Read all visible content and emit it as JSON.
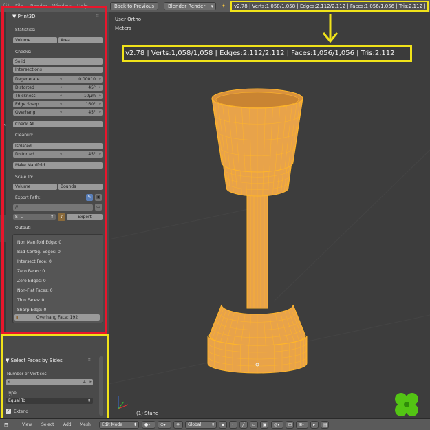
{
  "header": {
    "menus": [
      "File",
      "Render",
      "Window",
      "Help"
    ],
    "back_label": "Back to Previous",
    "engine": "Blender Render",
    "stats": "v2.78 | Verts:1,058/1,058 | Edges:2,112/2,112 | Faces:1,056/1,056 | Tris:2,112 | Mem:20"
  },
  "viewport": {
    "view_name": "User Ortho",
    "units": "Meters",
    "object_label": "(1) Stand",
    "callout_stats": "v2.78 | Verts:1,058/1,058 | Edges:2,112/2,112 | Faces:1,056/1,056 | Tris:2,112"
  },
  "tabs": [
    "Tools",
    "Create",
    "Relations",
    "Shading / UVs",
    "Options",
    "Grease Pencil",
    "Print3D"
  ],
  "print3d": {
    "title": "Print3D",
    "statistics_label": "Statistics:",
    "volume_btn": "Volume",
    "area_btn": "Area",
    "checks_label": "Checks:",
    "solid_btn": "Solid",
    "intersections_btn": "Intersections",
    "fields": [
      {
        "label": "Degenerate",
        "value": "0.00010"
      },
      {
        "label": "Distorted",
        "value": "45°"
      },
      {
        "label": "Thickness",
        "value": "10µm"
      },
      {
        "label": "Edge Sharp",
        "value": "160°"
      },
      {
        "label": "Overhang",
        "value": "45°"
      }
    ],
    "check_all_btn": "Check All",
    "cleanup_label": "Cleanup:",
    "isolated_btn": "Isolated",
    "cleanup_distorted_label": "Distorted",
    "cleanup_distorted_value": "45°",
    "make_manifold_btn": "Make Manifold",
    "scale_label": "Scale To:",
    "scale_volume_btn": "Volume",
    "scale_bounds_btn": "Bounds",
    "export_path_label": "Export Path:",
    "export_path_value": "//",
    "format_value": "STL",
    "export_btn": "Export",
    "output_label": "Output:",
    "output_items": [
      "Non Manifold Edge: 0",
      "Bad Contig. Edges: 0",
      "Intersect Face: 0",
      "Zero Faces: 0",
      "Zero Edges: 0",
      "Non-Flat Faces: 0",
      "Thin Faces: 0",
      "Sharp Edge: 0"
    ],
    "overhang_face_btn": "Overhang Face: 192"
  },
  "operator": {
    "title": "Select Faces by Sides",
    "vertices_label": "Number of Vertices",
    "vertices_value": "4",
    "type_label": "Type",
    "type_value": "Equal To",
    "extend_label": "Extend",
    "extend_checked": true
  },
  "footer": {
    "menus": [
      "View",
      "Select",
      "Add",
      "Mesh"
    ],
    "mode": "Edit Mode",
    "orientation": "Global"
  },
  "colors": {
    "mesh_fill": "#e8a34a",
    "mesh_wire": "#ffb52a",
    "highlight_red": "#e8162c",
    "highlight_yellow": "#f1e31a"
  }
}
